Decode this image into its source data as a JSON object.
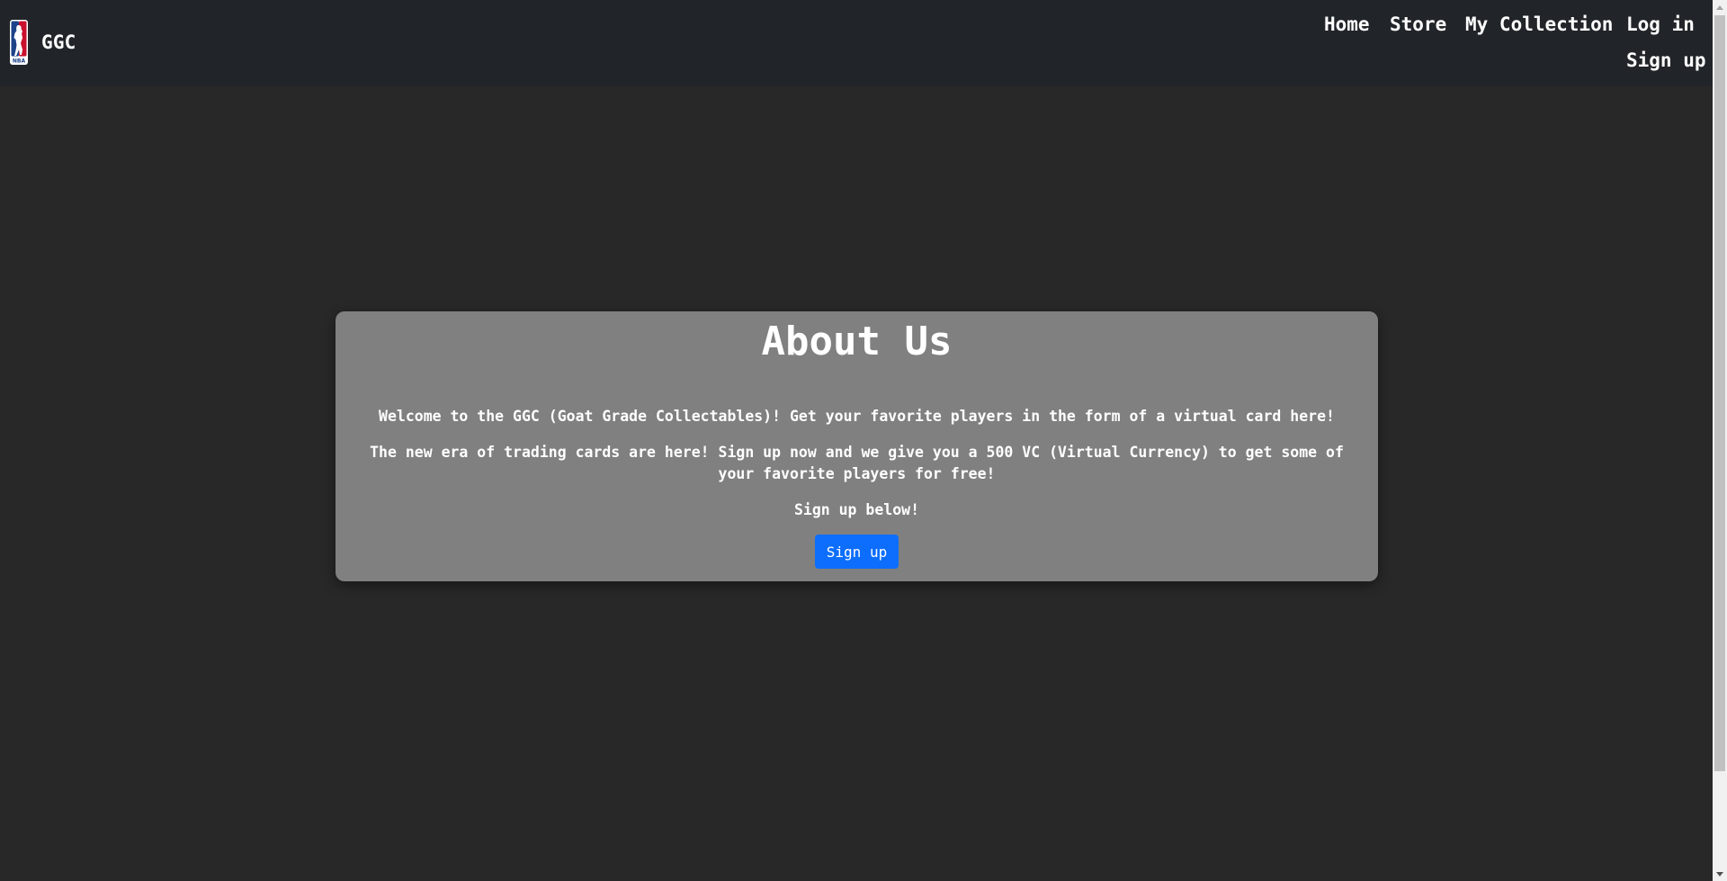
{
  "navbar": {
    "brand": "GGC",
    "brand_logo_icon": "nba-logo-icon",
    "links": {
      "home": "Home",
      "store": "Store",
      "collection": "My Collection",
      "login": "Log in",
      "signup": "Sign up"
    }
  },
  "about": {
    "title": "About Us",
    "paragraph1": "Welcome to the GGC (Goat Grade Collectables)! Get your favorite players in the form of a virtual card here!",
    "paragraph2": "The new era of trading cards are here! Sign up now and we give you a 500 VC (Virtual Currency) to get some of your favorite players for free!",
    "paragraph3": "Sign up below!",
    "button_label": "Sign up"
  },
  "colors": {
    "page_background": "#282828",
    "navbar_background": "#212529",
    "card_background": "#808080",
    "button_primary": "#0d6efd",
    "text": "#ffffff"
  }
}
